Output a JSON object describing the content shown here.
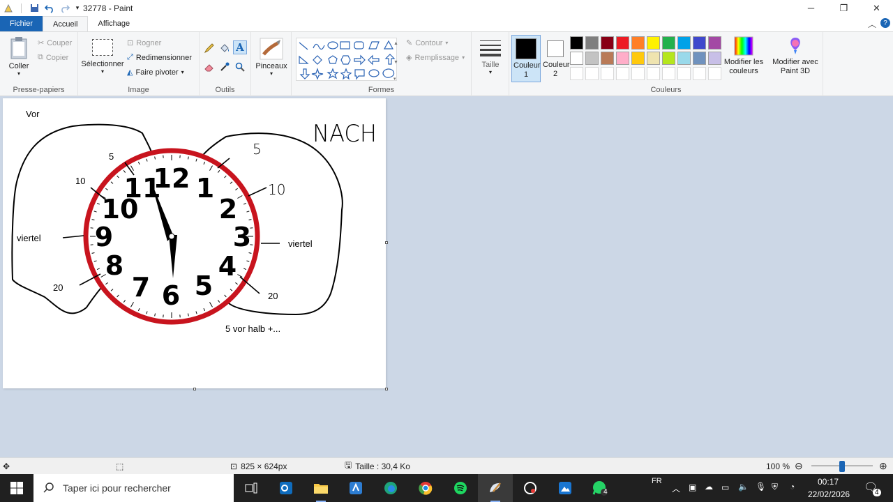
{
  "window": {
    "title": "32778 - Paint"
  },
  "tabs": {
    "file": "Fichier",
    "home": "Accueil",
    "view": "Affichage"
  },
  "clipboard": {
    "paste": "Coller",
    "cut": "Couper",
    "copy": "Copier",
    "label": "Presse-papiers"
  },
  "image": {
    "select": "Sélectionner",
    "crop": "Rogner",
    "resize": "Redimensionner",
    "rotate": "Faire pivoter",
    "label": "Image"
  },
  "tools": {
    "label": "Outils"
  },
  "brushes": {
    "label": "Pinceaux"
  },
  "shapes": {
    "outline": "Contour",
    "fill": "Remplissage",
    "label": "Formes"
  },
  "size": {
    "label": "Taille"
  },
  "colors": {
    "color1": "Couleur 1",
    "color2": "Couleur 2",
    "edit": "Modifier les couleurs",
    "paint3d": "Modifier avec Paint 3D",
    "label": "Couleurs",
    "palette_row1": [
      "#000000",
      "#7f7f7f",
      "#880015",
      "#ed1c24",
      "#ff7f27",
      "#fff200",
      "#22b14c",
      "#00a2e8",
      "#3f48cc",
      "#a349a4"
    ],
    "palette_row2": [
      "#ffffff",
      "#c3c3c3",
      "#b97a57",
      "#ffaec9",
      "#ffc90e",
      "#efe4b0",
      "#b5e61d",
      "#99d9ea",
      "#7092be",
      "#c8bfe7"
    ]
  },
  "drawing": {
    "vor": "Vor",
    "nach": "NACH",
    "left_5": "5",
    "left_10": "10",
    "left_viertel": "viertel",
    "left_20": "20",
    "right_5": "5",
    "right_10": "10",
    "right_viertel": "viertel",
    "right_20": "20",
    "caption": "5 vor halb +...",
    "numerals": [
      "12",
      "1",
      "2",
      "3",
      "4",
      "5",
      "6",
      "7",
      "8",
      "9",
      "10",
      "11"
    ]
  },
  "status": {
    "dimensions": "825 × 624px",
    "filesize": "Taille : 30,4 Ko",
    "zoom": "100 %"
  },
  "taskbar": {
    "search_placeholder": "Taper ici pour rechercher",
    "lang": "FR",
    "time": "00:17",
    "date": "22/02/2026",
    "notif_count": "4",
    "whatsapp_badge": "4"
  }
}
